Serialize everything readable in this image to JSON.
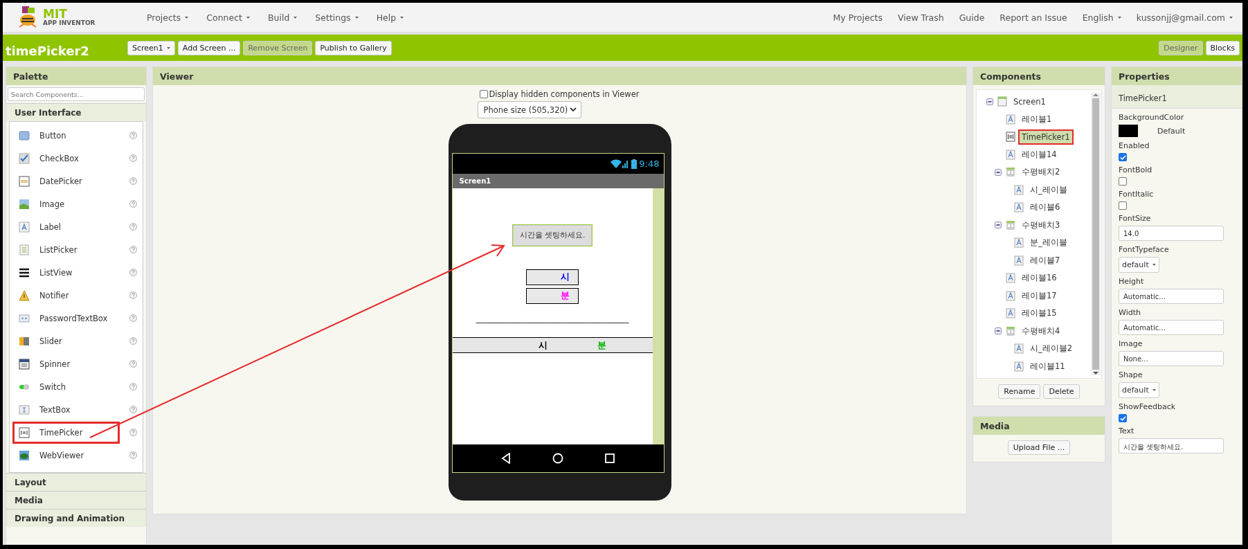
{
  "logo": {
    "title": "MIT",
    "subtitle": "APP INVENTOR"
  },
  "nav_left": [
    {
      "label": "Projects",
      "dropdown": true
    },
    {
      "label": "Connect",
      "dropdown": true
    },
    {
      "label": "Build",
      "dropdown": true
    },
    {
      "label": "Settings",
      "dropdown": true
    },
    {
      "label": "Help",
      "dropdown": true
    }
  ],
  "nav_right": [
    {
      "label": "My Projects",
      "dropdown": false
    },
    {
      "label": "View Trash",
      "dropdown": false
    },
    {
      "label": "Guide",
      "dropdown": false
    },
    {
      "label": "Report an Issue",
      "dropdown": false
    },
    {
      "label": "English",
      "dropdown": true
    },
    {
      "label": "kussonjj@gmail.com",
      "dropdown": true
    }
  ],
  "project_title": "timePicker2",
  "toolbar": [
    {
      "label": "Screen1",
      "dropdown": true,
      "disabled": false
    },
    {
      "label": "Add Screen ...",
      "dropdown": false,
      "disabled": false
    },
    {
      "label": "Remove Screen",
      "dropdown": false,
      "disabled": true
    },
    {
      "label": "Publish to Gallery",
      "dropdown": false,
      "disabled": false
    }
  ],
  "mode_tabs": [
    {
      "label": "Designer",
      "selected": true
    },
    {
      "label": "Blocks",
      "selected": false
    }
  ],
  "palette": {
    "title": "Palette",
    "search": {
      "placeholder": "Search Components..."
    },
    "sections": [
      {
        "title": "User Interface",
        "expanded": true,
        "items": [
          {
            "label": "Button",
            "kind": "button",
            "annotated": false
          },
          {
            "label": "CheckBox",
            "kind": "checkbox",
            "annotated": false
          },
          {
            "label": "DatePicker",
            "kind": "datepicker",
            "annotated": false
          },
          {
            "label": "Image",
            "kind": "image",
            "annotated": false
          },
          {
            "label": "Label",
            "kind": "label",
            "annotated": false
          },
          {
            "label": "ListPicker",
            "kind": "listpicker",
            "annotated": false
          },
          {
            "label": "ListView",
            "kind": "listview",
            "annotated": false
          },
          {
            "label": "Notifier",
            "kind": "notifier",
            "annotated": false
          },
          {
            "label": "PasswordTextBox",
            "kind": "password",
            "annotated": false
          },
          {
            "label": "Slider",
            "kind": "slider",
            "annotated": false
          },
          {
            "label": "Spinner",
            "kind": "spinner",
            "annotated": false
          },
          {
            "label": "Switch",
            "kind": "switch",
            "annotated": false
          },
          {
            "label": "TextBox",
            "kind": "textbox",
            "annotated": false
          },
          {
            "label": "TimePicker",
            "kind": "timepicker",
            "annotated": true
          },
          {
            "label": "WebViewer",
            "kind": "webviewer",
            "annotated": false
          }
        ]
      },
      {
        "title": "Layout"
      },
      {
        "title": "Media"
      },
      {
        "title": "Drawing and Animation"
      }
    ]
  },
  "viewer": {
    "title": "Viewer",
    "hidden_checkbox": {
      "label": "Display hidden components in Viewer",
      "checked": false
    },
    "size_select": "Phone size (505,320)",
    "phone": {
      "time": "9:48",
      "screen_title": "Screen1",
      "button": "시간을 셋팅하세요.",
      "boxes": [
        {
          "text": "시",
          "color": "#0000ff"
        },
        {
          "text": "분",
          "color": "#ff00ff"
        }
      ],
      "divider_label": "______________________________________",
      "band": [
        {
          "text": "시",
          "color": "#000000"
        },
        {
          "text": "분",
          "color": "#00b000"
        }
      ]
    }
  },
  "components": {
    "title": "Components",
    "tree": [
      {
        "name": "Screen1",
        "kind": "screen",
        "expanded": true,
        "selected": false,
        "annotated": false,
        "children": [
          {
            "name": "레이블1",
            "kind": "label",
            "selected": false,
            "annotated": false
          },
          {
            "name": "TimePicker1",
            "kind": "timepicker",
            "selected": true,
            "annotated": true
          },
          {
            "name": "레이블14",
            "kind": "label",
            "selected": false,
            "annotated": false
          },
          {
            "name": "수평배치2",
            "kind": "arrangement",
            "expanded": true,
            "selected": false,
            "annotated": false,
            "children": [
              {
                "name": "시_레이블",
                "kind": "label",
                "selected": false,
                "annotated": false
              },
              {
                "name": "레이블6",
                "kind": "label",
                "selected": false,
                "annotated": false
              }
            ]
          },
          {
            "name": "수평배치3",
            "kind": "arrangement",
            "expanded": true,
            "selected": false,
            "annotated": false,
            "children": [
              {
                "name": "분_레이블",
                "kind": "label",
                "selected": false,
                "annotated": false
              },
              {
                "name": "레이블7",
                "kind": "label",
                "selected": false,
                "annotated": false
              }
            ]
          },
          {
            "name": "레이블16",
            "kind": "label",
            "selected": false,
            "annotated": false
          },
          {
            "name": "레이블17",
            "kind": "label",
            "selected": false,
            "annotated": false
          },
          {
            "name": "레이블15",
            "kind": "label",
            "selected": false,
            "annotated": false
          },
          {
            "name": "수평배치4",
            "kind": "arrangement",
            "expanded": true,
            "selected": false,
            "annotated": false,
            "children": [
              {
                "name": "시_레이블2",
                "kind": "label",
                "selected": false,
                "annotated": false
              },
              {
                "name": "레이블11",
                "kind": "label",
                "selected": false,
                "annotated": false
              }
            ]
          }
        ]
      }
    ],
    "buttons": [
      "Rename",
      "Delete"
    ]
  },
  "media": {
    "title": "Media",
    "button": "Upload File ..."
  },
  "properties": {
    "title": "Properties",
    "component": "TimePicker1",
    "items": [
      {
        "name": "BackgroundColor",
        "kind": "color",
        "value": "Default",
        "color": "#000000"
      },
      {
        "name": "Enabled",
        "kind": "checkbox",
        "checked": true
      },
      {
        "name": "FontBold",
        "kind": "checkbox",
        "checked": false
      },
      {
        "name": "FontItalic",
        "kind": "checkbox",
        "checked": false
      },
      {
        "name": "FontSize",
        "kind": "field",
        "value": "14.0"
      },
      {
        "name": "FontTypeface",
        "kind": "dropdown",
        "value": "default"
      },
      {
        "name": "Height",
        "kind": "field",
        "value": "Automatic..."
      },
      {
        "name": "Width",
        "kind": "field",
        "value": "Automatic..."
      },
      {
        "name": "Image",
        "kind": "field",
        "value": "None..."
      },
      {
        "name": "Shape",
        "kind": "dropdown",
        "value": "default"
      },
      {
        "name": "ShowFeedback",
        "kind": "checkbox",
        "checked": true
      },
      {
        "name": "Text",
        "kind": "field",
        "value": "시간을 셋팅하세요."
      }
    ]
  }
}
